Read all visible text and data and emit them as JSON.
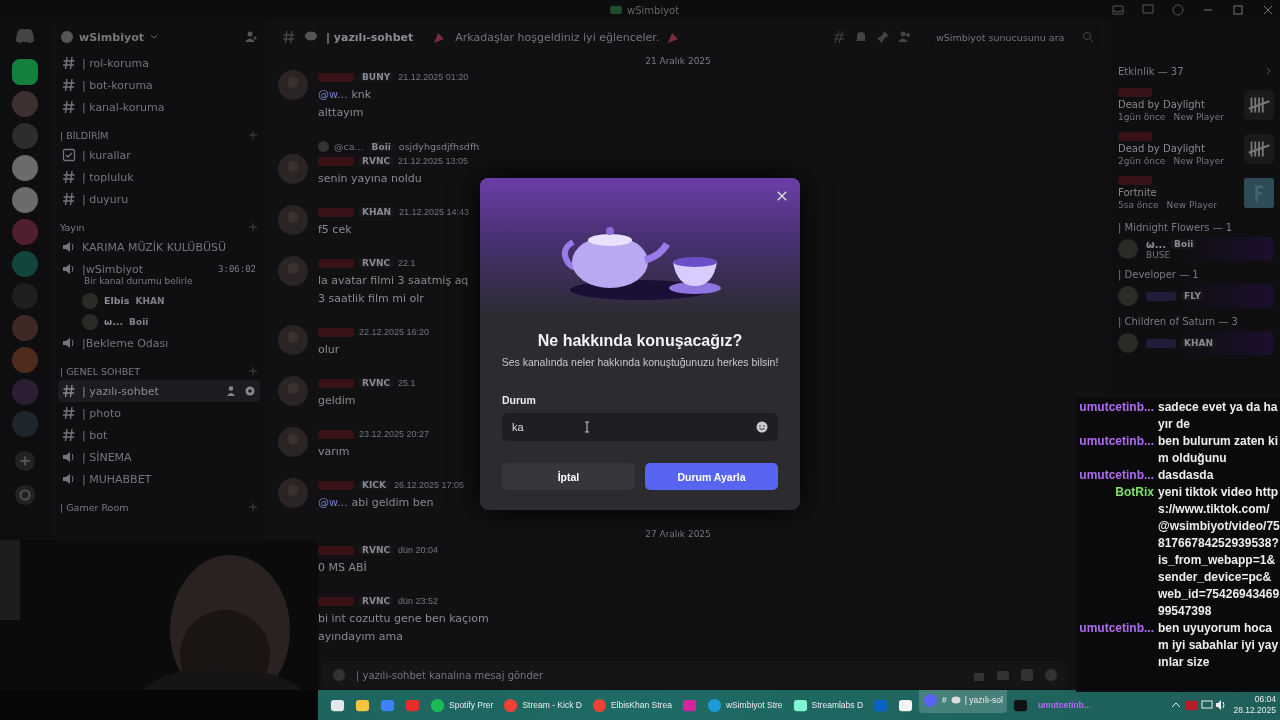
{
  "window": {
    "title": "wSimbiyot"
  },
  "servers": [
    {
      "selected": true
    },
    {
      "selected": false
    },
    {
      "selected": false
    },
    {
      "selected": false
    },
    {
      "selected": false
    },
    {
      "selected": false
    },
    {
      "selected": false
    },
    {
      "selected": false
    },
    {
      "selected": false
    },
    {
      "selected": false
    },
    {
      "selected": false
    },
    {
      "selected": false
    }
  ],
  "server": {
    "name": "wSimbiyot"
  },
  "channels": [
    {
      "kind": "text",
      "name": "| rol-koruma",
      "selected": false
    },
    {
      "kind": "text",
      "name": "| bot-koruma",
      "selected": false
    },
    {
      "kind": "text",
      "name": "| kanal-koruma",
      "selected": false
    },
    {
      "kind": "category",
      "name": "| BİLDİRİM"
    },
    {
      "kind": "rules",
      "name": "| kurallar",
      "selected": false
    },
    {
      "kind": "text",
      "name": "| topluluk",
      "selected": false
    },
    {
      "kind": "text",
      "name": "| duyuru",
      "selected": false
    },
    {
      "kind": "category",
      "name": "Yayın"
    },
    {
      "kind": "voice",
      "name": "KARIMA MÜZİK KULÜBÜSÜ",
      "selected": false
    },
    {
      "kind": "voice",
      "name": "|wSimbiyot",
      "selected": false,
      "timer": "3:06:02",
      "status": "Bir kanal durumu belirle",
      "members": [
        {
          "name": "Elbis",
          "badge": "KHAN"
        },
        {
          "name": "ω...",
          "badge": "Boii"
        }
      ]
    },
    {
      "kind": "voice",
      "name": "|Bekleme Odası",
      "selected": false
    },
    {
      "kind": "category",
      "name": "| GENEL SOHBET"
    },
    {
      "kind": "text",
      "name": "| yazılı-sohbet",
      "selected": true
    },
    {
      "kind": "text",
      "name": "| photo",
      "selected": false
    },
    {
      "kind": "text",
      "name": "| bot",
      "selected": false
    },
    {
      "kind": "voice",
      "name": "| SİNEMA",
      "selected": false
    },
    {
      "kind": "voice",
      "name": "| MUHABBET",
      "selected": false
    },
    {
      "kind": "category",
      "name": "| Gamer Room"
    }
  ],
  "channel": {
    "name": "| yazılı-sohbet",
    "topic": "Arkadaşlar hoşgeldiniz iyi eğlenceler.",
    "search": {
      "placeholder": "wSimbiyot sunucusunu ara"
    }
  },
  "messages": [
    {
      "kind": "date",
      "text": "21 Aralık 2025"
    },
    {
      "kind": "message",
      "avatar": true,
      "badge": "BUNY",
      "time": "21.12.2025 01:20",
      "mention": "@w...",
      "lines": [
        "knk",
        "alttayım"
      ]
    },
    {
      "kind": "message",
      "avatar": true,
      "reply": {
        "user": "@ca...",
        "badge": "Boii",
        "text": "osjdyhgsdjfhsdfh"
      },
      "badge": "RVNC",
      "time": "21.12.2025 13:05",
      "lines": [
        "senin yayına noldu"
      ]
    },
    {
      "kind": "message",
      "avatar": true,
      "badge": "KHAN",
      "time": "21.12.2025 14:43",
      "lines": [
        "f5 cek"
      ]
    },
    {
      "kind": "message",
      "avatar": true,
      "badge": "RVNC",
      "time": "22.1",
      "lines": [
        "la avatar filmi 3 saatmiş aq",
        "3 saatlik film mi olr"
      ]
    },
    {
      "kind": "message",
      "avatar": true,
      "time": "22.12.2025 16:20",
      "lines": [
        "olur"
      ]
    },
    {
      "kind": "message",
      "avatar": true,
      "badge": "RVNC",
      "time": "25.1",
      "lines": [
        "geldim"
      ]
    },
    {
      "kind": "message",
      "avatar": true,
      "time": "23.12.2025 20:27",
      "lines": [
        "varım"
      ]
    },
    {
      "kind": "message",
      "avatar": true,
      "badge": "KICK",
      "time": "26.12.2025 17:05",
      "mention": "@w...",
      "lines": [
        "abi geldim ben"
      ]
    },
    {
      "kind": "date",
      "text": "27 Aralık 2025"
    },
    {
      "kind": "message",
      "badge": "RVNC",
      "time": "dün 20:04",
      "lines": [
        "0 MS ABİ"
      ]
    },
    {
      "kind": "message",
      "badge": "RVNC",
      "time": "dün 23:52",
      "lines": [
        "bi int cozuttu gene ben kaçıom",
        "ayındayım ama"
      ]
    }
  ],
  "composer": {
    "placeholder": "| yazılı-sohbet kanalına mesaj gönder"
  },
  "members": {
    "activity_header": "Etkinlik — 37",
    "activities": [
      {
        "kind": "tally",
        "game": "Dead by Daylight",
        "ago": "1gün önce",
        "rank": "New Player"
      },
      {
        "kind": "tally",
        "game": "Dead by Daylight",
        "ago": "2gün önce",
        "rank": "New Player"
      },
      {
        "kind": "tile",
        "game": "Fortnite",
        "ago": "5sa önce",
        "rank": "New Player"
      }
    ],
    "groups": [
      {
        "title": "| Midnight Flowers — 1",
        "members": [
          {
            "name": "ω...",
            "badge": "Boii",
            "status": "BUSE"
          }
        ]
      },
      {
        "title": "| Developer — 1",
        "members": [
          {
            "badge": "FLY"
          }
        ]
      },
      {
        "title": "| Children of Saturn — 3",
        "members": [
          {
            "badge": "KHAN"
          }
        ]
      }
    ]
  },
  "stream_chat": [
    {
      "user": "umutcetinb...",
      "color": "#b06cf0",
      "text": "sadece evet ya da hayır de"
    },
    {
      "user": "umutcetinb...",
      "color": "#b06cf0",
      "text": "ben bulurum zaten kim olduğunu"
    },
    {
      "user": "umutcetinb...",
      "color": "#b06cf0",
      "text": "dasdasda"
    },
    {
      "user": "BotRix",
      "color": "#7de06a",
      "text": "yeni tiktok video https://www.tiktok.com/@wsimbiyot/video/7581766784252939538?is_from_webapp=1&sender_device=pc&web_id=7542694346999547398"
    },
    {
      "user": "umutcetinb...",
      "color": "#b06cf0",
      "text": "ben uyuyorum hocam iyi sabahlar iyi yayınlar size"
    }
  ],
  "modal": {
    "title": "Ne hakkında konuşacağız?",
    "subtitle": "Ses kanalında neler hakkında konuştuğunuzu herkes bilsin!",
    "label": "Durum",
    "value": "ka",
    "cancel": "İptal",
    "confirm": "Durum Ayarla"
  },
  "taskbar": {
    "items": [
      {
        "kind": "taskview",
        "selected": false
      },
      {
        "kind": "folder",
        "selected": false
      },
      {
        "kind": "store",
        "selected": false
      },
      {
        "kind": "youtube",
        "selected": false
      },
      {
        "kind": "spotify",
        "label": "Spotify Prer",
        "selected": false
      },
      {
        "kind": "chrome",
        "label": "Stream - Kick D",
        "selected": false
      },
      {
        "kind": "chrome",
        "label": "ElbisKhan Strea",
        "selected": false
      },
      {
        "kind": "instagram",
        "selected": false
      },
      {
        "kind": "edge",
        "label": "wSimbiyot Stre",
        "selected": false
      },
      {
        "kind": "streamlabs",
        "label": "Streamlabs D",
        "selected": false
      },
      {
        "kind": "outlook",
        "selected": false
      },
      {
        "kind": "capcut",
        "selected": false
      },
      {
        "kind": "discord",
        "prefix": "#",
        "label": "| yazılı-sol",
        "selected": true
      },
      {
        "kind": "tiktok",
        "selected": false
      },
      {
        "kind": "text",
        "label": "umutcetinb...",
        "selected": false
      }
    ],
    "time": "06:04",
    "date": "28.12.2025"
  }
}
